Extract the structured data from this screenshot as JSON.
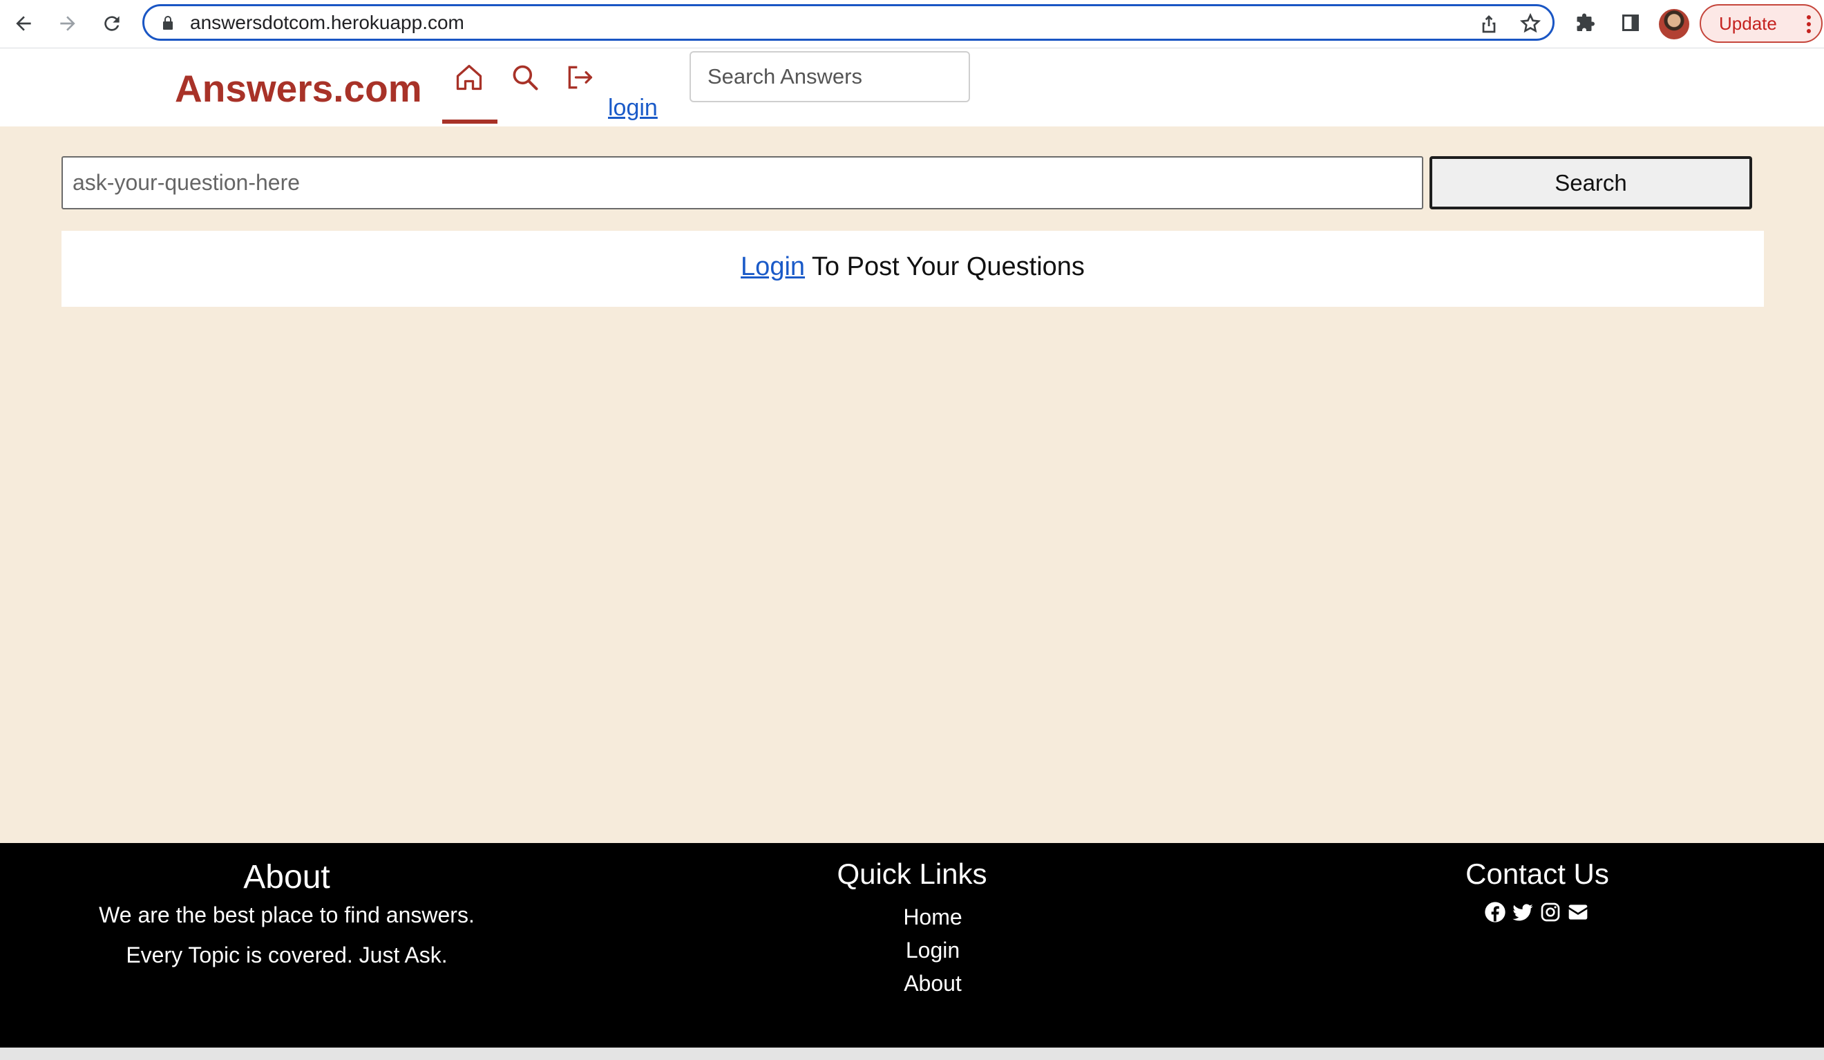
{
  "browser": {
    "url": "answersdotcom.herokuapp.com",
    "update_label": "Update"
  },
  "header": {
    "brand": "Answers.com",
    "login_link": "login",
    "search_placeholder": "Search Answers"
  },
  "main": {
    "question_placeholder": "ask-your-question-here",
    "search_button": "Search",
    "notice_link": "Login",
    "notice_text": " To Post Your Questions"
  },
  "footer": {
    "about": {
      "title": "About",
      "line1": "We are the best place to find answers.",
      "line2": "Every Topic is covered. Just Ask."
    },
    "quick_links": {
      "title": "Quick Links",
      "items": [
        "Home",
        "Login",
        "About"
      ]
    },
    "contact": {
      "title": "Contact Us",
      "icons": [
        "facebook-icon",
        "twitter-icon",
        "instagram-icon",
        "envelope-icon"
      ]
    }
  },
  "colors": {
    "brand": "#a83228",
    "page_background": "#f6ebdb",
    "footer_background": "#000000",
    "link": "#1a5ac8"
  }
}
